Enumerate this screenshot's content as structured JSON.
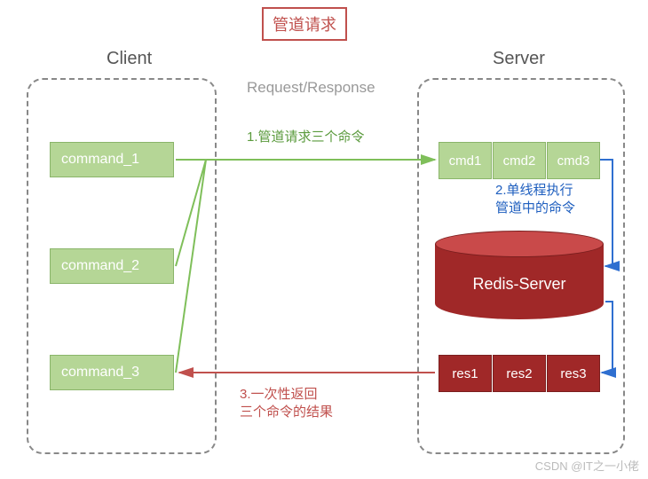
{
  "title": "管道请求",
  "headers": {
    "client": "Client",
    "server": "Server"
  },
  "reqresp": "Request/Response",
  "client_commands": [
    "command_1",
    "command_2",
    "command_3"
  ],
  "server_cmds": [
    "cmd1",
    "cmd2",
    "cmd3"
  ],
  "server_results": [
    "res1",
    "res2",
    "res3"
  ],
  "redis_label": "Redis-Server",
  "steps": {
    "s1": "1.管道请求三个命令",
    "s2_line1": "2.单线程执行",
    "s2_line2": "管道中的命令",
    "s3_line1": "3.一次性返回",
    "s3_line2": "三个命令的结果"
  },
  "watermark": "CSDN @IT之一小佬",
  "colors": {
    "green_box": "#b5d696",
    "red_box": "#a02828",
    "arrow_green": "#7fbf5a",
    "arrow_blue": "#2f6fd0",
    "arrow_red": "#c0504d"
  }
}
